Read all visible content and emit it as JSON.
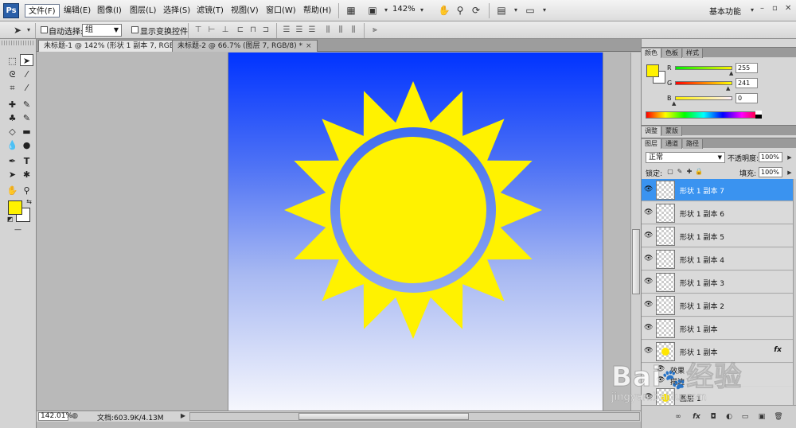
{
  "menubar": {
    "logo": "Ps",
    "items": [
      "文件(F)",
      "编辑(E)",
      "图像(I)",
      "图层(L)",
      "选择(S)",
      "滤镜(T)",
      "视图(V)",
      "窗口(W)",
      "帮助(H)"
    ],
    "zoom": "142%",
    "workspace": "基本功能",
    "window_controls": [
      "–",
      "▫",
      "✕"
    ]
  },
  "options_bar": {
    "auto_select_label": "自动选择:",
    "auto_select_value": "组",
    "show_transform_label": "显示变换控件"
  },
  "tabs": [
    {
      "label": "未标题-1 @ 142% (形状 1 副本 7, RGB/8) *",
      "close": "×"
    },
    {
      "label": "未标题-2 @ 66.7% (图层 7, RGB/8) *",
      "close": "×"
    }
  ],
  "status_bar": {
    "zoom": "142.01%",
    "doc_info": "文档:603.9K/4.13M"
  },
  "color_panel": {
    "tabs": [
      "颜色",
      "色板",
      "样式"
    ],
    "channels": [
      {
        "label": "R",
        "value": "255",
        "level": 1.0
      },
      {
        "label": "G",
        "value": "241",
        "level": 0.945
      },
      {
        "label": "B",
        "value": "0",
        "level": 0.0
      }
    ],
    "fg_color": "#fff200",
    "bg_color": "#ffffff"
  },
  "adjust_tabs": [
    "调整",
    "蒙版"
  ],
  "layers_panel": {
    "tabs": [
      "图层",
      "通道",
      "路径"
    ],
    "blend_mode": "正常",
    "opacity_label": "不透明度:",
    "opacity_value": "100%",
    "lock_label": "锁定:",
    "fill_label": "填充:",
    "fill_value": "100%",
    "layers": [
      {
        "name": "形状 1 副本 7",
        "selected": true,
        "thumb": "transparent"
      },
      {
        "name": "形状 1 副本 6",
        "selected": false,
        "thumb": "transparent"
      },
      {
        "name": "形状 1 副本 5",
        "selected": false,
        "thumb": "transparent"
      },
      {
        "name": "形状 1 副本 4",
        "selected": false,
        "thumb": "transparent"
      },
      {
        "name": "形状 1 副本 3",
        "selected": false,
        "thumb": "transparent"
      },
      {
        "name": "形状 1 副本 2",
        "selected": false,
        "thumb": "transparent"
      },
      {
        "name": "形状 1 副本",
        "selected": false,
        "thumb": "transparent"
      },
      {
        "name": "形状 1 副本",
        "selected": false,
        "thumb": "yellow",
        "fx": "fx"
      }
    ],
    "effects": [
      "效果",
      "描边"
    ],
    "bottom_layer": {
      "name": "图层 1",
      "thumb": "yellow"
    }
  },
  "watermark": {
    "brand": "Bai",
    "brand_cn": "经验",
    "url": "jingyan.baidu.com"
  },
  "colors": {
    "sky_top": "#0033ff",
    "sky_bottom": "#ffffff",
    "sun": "#fff200",
    "ring": "#6f8ff0",
    "selection": "#3a93f0"
  }
}
